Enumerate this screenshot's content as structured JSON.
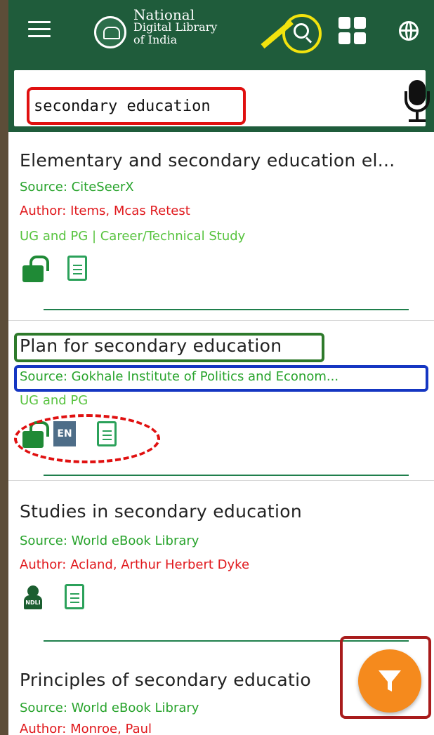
{
  "header": {
    "logo_line1": "National",
    "logo_line2": "Digital Library",
    "logo_line3": "of India"
  },
  "search": {
    "query": "secondary education"
  },
  "results": [
    {
      "title": "Elementary and secondary education el...",
      "source": "Source: CiteSeerX",
      "author": "Author: Items, Mcas Retest",
      "level": "UG and PG | Career/Technical Study",
      "icons": [
        "open-access-lock-icon",
        "document-icon"
      ]
    },
    {
      "title": "Plan for secondary education",
      "source": "Source: Gokhale Institute of Politics and Econom...",
      "level": "UG and PG",
      "language_badge": "EN",
      "icons": [
        "open-access-lock-icon",
        "language-badge",
        "document-icon"
      ]
    },
    {
      "title": "Studies in secondary education",
      "source": "Source: World eBook Library",
      "author": "Author: Acland, Arthur Herbert Dyke",
      "icons": [
        "ndli-user-icon",
        "document-icon"
      ],
      "ndli_label": "NDLI"
    },
    {
      "title": "Principles of secondary educatio",
      "source": "Source: World eBook Library",
      "author": "Author: Monroe, Paul"
    }
  ],
  "colors": {
    "app_bar": "#1f5c3b",
    "source_green": "#27a32b",
    "author_red": "#e0181c",
    "fab_orange": "#f58a1d",
    "highlight_yellow": "#f2e30e"
  }
}
